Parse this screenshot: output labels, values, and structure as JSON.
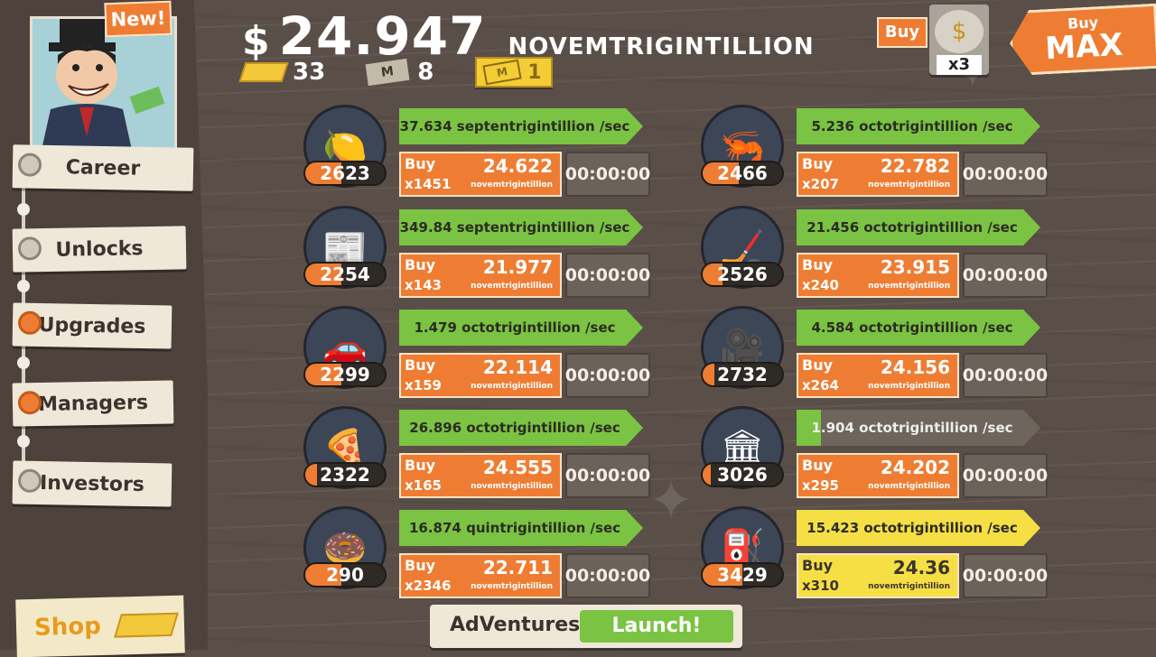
{
  "header": {
    "currency_symbol": "$",
    "money_amount": "24.947",
    "money_unit": "NOVEMTRIGINTILLION",
    "gold_count": "33",
    "megabucks_count": "8",
    "tickets_count": "1",
    "new_badge": "New!"
  },
  "buy_controls": {
    "buy_label": "Buy",
    "multiplier": "x3",
    "buy_max_line1": "Buy",
    "buy_max_line2": "MAX"
  },
  "nav": {
    "items": [
      {
        "label": "Career",
        "active": false
      },
      {
        "label": "Unlocks",
        "active": false
      },
      {
        "label": "Upgrades",
        "active": true
      },
      {
        "label": "Managers",
        "active": true
      },
      {
        "label": "Investors",
        "active": false
      }
    ],
    "shop_label": "Shop"
  },
  "businesses": [
    {
      "icon": "lemon-icon",
      "glyph": "🍋",
      "count": "2623",
      "fill": 0.45,
      "rate": "37.634 septentrigintillion /sec",
      "rate_style": "green",
      "buy": "Buy",
      "qty": "x1451",
      "cost": "24.622",
      "cost_unit": "novemtrigintillion",
      "timer": "00:00:00"
    },
    {
      "icon": "newspaper-icon",
      "glyph": "📰",
      "count": "2254",
      "fill": 0.45,
      "rate": "349.84 septentrigintillion /sec",
      "rate_style": "green",
      "buy": "Buy",
      "qty": "x143",
      "cost": "21.977",
      "cost_unit": "novemtrigintillion",
      "timer": "00:00:00"
    },
    {
      "icon": "car-wash-icon",
      "glyph": "🚗",
      "count": "2299",
      "fill": 0.45,
      "rate": "1.479 octotrigintillion /sec",
      "rate_style": "green",
      "buy": "Buy",
      "qty": "x159",
      "cost": "22.114",
      "cost_unit": "novemtrigintillion",
      "timer": "00:00:00"
    },
    {
      "icon": "pizza-icon",
      "glyph": "🍕",
      "count": "2322",
      "fill": 0.15,
      "rate": "26.896 octotrigintillion /sec",
      "rate_style": "green",
      "buy": "Buy",
      "qty": "x165",
      "cost": "24.555",
      "cost_unit": "novemtrigintillion",
      "timer": "00:00:00"
    },
    {
      "icon": "donut-icon",
      "glyph": "🍩",
      "count": "290",
      "fill": 0.45,
      "rate": "16.874 quintrigintillion /sec",
      "rate_style": "green",
      "buy": "Buy",
      "qty": "x2346",
      "cost": "22.711",
      "cost_unit": "novemtrigintillion",
      "timer": "00:00:00"
    },
    {
      "icon": "shrimp-icon",
      "glyph": "🦐",
      "count": "2466",
      "fill": 0.45,
      "rate": "5.236 octotrigintillion /sec",
      "rate_style": "green",
      "buy": "Buy",
      "qty": "x207",
      "cost": "22.782",
      "cost_unit": "novemtrigintillion",
      "timer": "00:00:00"
    },
    {
      "icon": "hockey-icon",
      "glyph": "🏒",
      "count": "2526",
      "fill": 0.25,
      "rate": "21.456 octotrigintillion /sec",
      "rate_style": "green",
      "buy": "Buy",
      "qty": "x240",
      "cost": "23.915",
      "cost_unit": "novemtrigintillion",
      "timer": "00:00:00"
    },
    {
      "icon": "movie-camera-icon",
      "glyph": "🎥",
      "count": "2732",
      "fill": 0.15,
      "rate": "4.584 octotrigintillion /sec",
      "rate_style": "green",
      "buy": "Buy",
      "qty": "x264",
      "cost": "24.156",
      "cost_unit": "novemtrigintillion",
      "timer": "00:00:00"
    },
    {
      "icon": "bank-icon",
      "glyph": "🏛",
      "count": "3026",
      "fill": 0.1,
      "rate": "1.904 octotrigintillion /sec",
      "rate_style": "grey",
      "rate_progress": 0.1,
      "buy": "Buy",
      "qty": "x295",
      "cost": "24.202",
      "cost_unit": "novemtrigintillion",
      "timer": "00:00:00"
    },
    {
      "icon": "oil-rig-icon",
      "glyph": "⛽",
      "count": "3429",
      "fill": 0.5,
      "rate": "15.423 octotrigintillion /sec",
      "rate_style": "gold",
      "buy": "Buy",
      "qty": "x310",
      "cost": "24.36",
      "cost_unit": "novemtrigintillion",
      "timer": "00:00:00"
    }
  ],
  "footer": {
    "adventures_label": "AdVentures",
    "launch_label": "Launch!"
  },
  "colors": {
    "orange": "#ee7d33",
    "green": "#7bc343",
    "gold": "#f6df45",
    "background": "#5a4f48"
  }
}
